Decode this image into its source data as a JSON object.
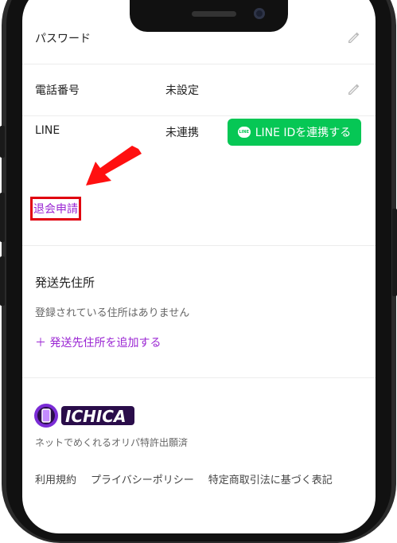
{
  "account_rows": [
    {
      "label": "パスワード",
      "value": "",
      "action": "pencil-icon"
    },
    {
      "label": "電話番号",
      "value": "未設定",
      "action": "pencil-icon"
    },
    {
      "label": "LINE",
      "value": "未連携",
      "action": "line-button"
    }
  ],
  "line_button_label": "LINE IDを連携する",
  "withdraw_link": "退会申請",
  "shipping": {
    "title": "発送先住所",
    "empty_note": "登録されている住所はありません",
    "add_link": "＋ 発送先住所を追加する"
  },
  "brand": {
    "logo_text": "ICHICA",
    "tagline": "ネットでめくれるオリパ特許出願済"
  },
  "footer_links": [
    "利用規約",
    "プライバシーポリシー",
    "特定商取引法に基づく表記"
  ],
  "colors": {
    "accent": "#9b27d3",
    "line_green": "#06c755",
    "highlight_red": "#e0000f",
    "arrow_red": "#ff1010"
  }
}
